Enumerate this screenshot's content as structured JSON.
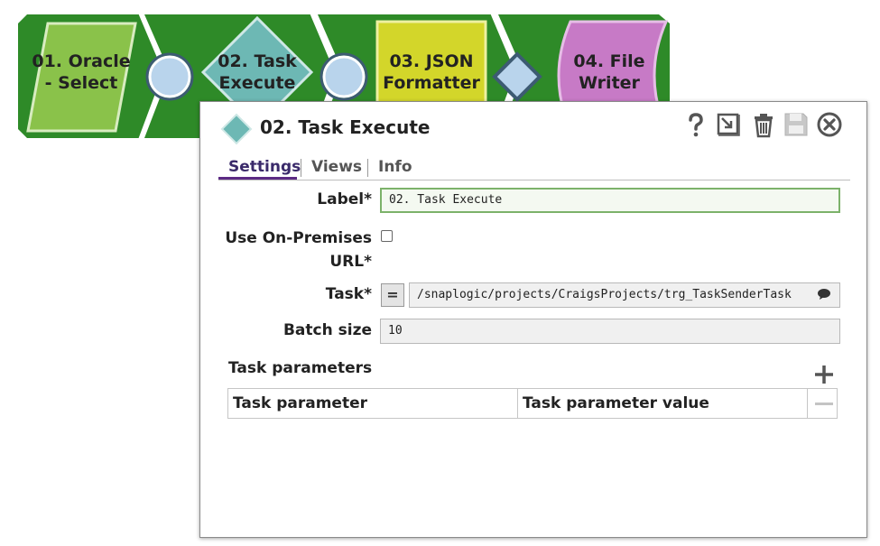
{
  "pipeline": {
    "snaps": [
      {
        "label_line1": "01. Oracle",
        "label_line2": "- Select",
        "color": "#8ac24a",
        "shape": "parallelogram"
      },
      {
        "label_line1": "02. Task",
        "label_line2": "Execute",
        "color": "#6db8b4",
        "shape": "diamond"
      },
      {
        "label_line1": "03. JSON",
        "label_line2": "Formatter",
        "color": "#d3d62a",
        "shape": "square"
      },
      {
        "label_line1": "04. File",
        "label_line2": "Writer",
        "color": "#c77ac6",
        "shape": "curved"
      }
    ],
    "colors": {
      "band": "#2e8a28",
      "band_dark": "#216b1e",
      "port": "#b9d4ec",
      "port_ring": "#3d5b73"
    }
  },
  "dialog": {
    "title": "02. Task Execute",
    "toolbar": {
      "help_icon": "question-icon",
      "open_icon": "external-link-icon",
      "delete_icon": "trash-icon",
      "save_icon": "floppy-disk-icon",
      "close_icon": "close-circle-icon"
    },
    "tabs": [
      {
        "label": "Settings",
        "active": true
      },
      {
        "label": "Views",
        "active": false
      },
      {
        "label": "Info",
        "active": false
      }
    ],
    "fields": {
      "label": {
        "label": "Label*",
        "value": "02. Task Execute"
      },
      "use_onprem": {
        "label_line1": "Use On-Premises",
        "label_line2": "URL*",
        "checked": false
      },
      "task": {
        "label": "Task*",
        "expr_button": "=",
        "value": "/snaplogic/projects/CraigsProjects/trg_TaskSenderTask",
        "suggest_icon": "speech-bubble-icon"
      },
      "batch_size": {
        "label": "Batch size",
        "value": "10"
      }
    },
    "task_parameters": {
      "title": "Task parameters",
      "add_icon": "plus-icon",
      "remove_icon": "minus-icon",
      "columns": [
        "Task parameter",
        "Task parameter value"
      ],
      "rows": []
    },
    "colors": {
      "tab_active": "#5c2a84",
      "input_focus": "#7cb26a",
      "icon_gray": "#555555"
    }
  }
}
